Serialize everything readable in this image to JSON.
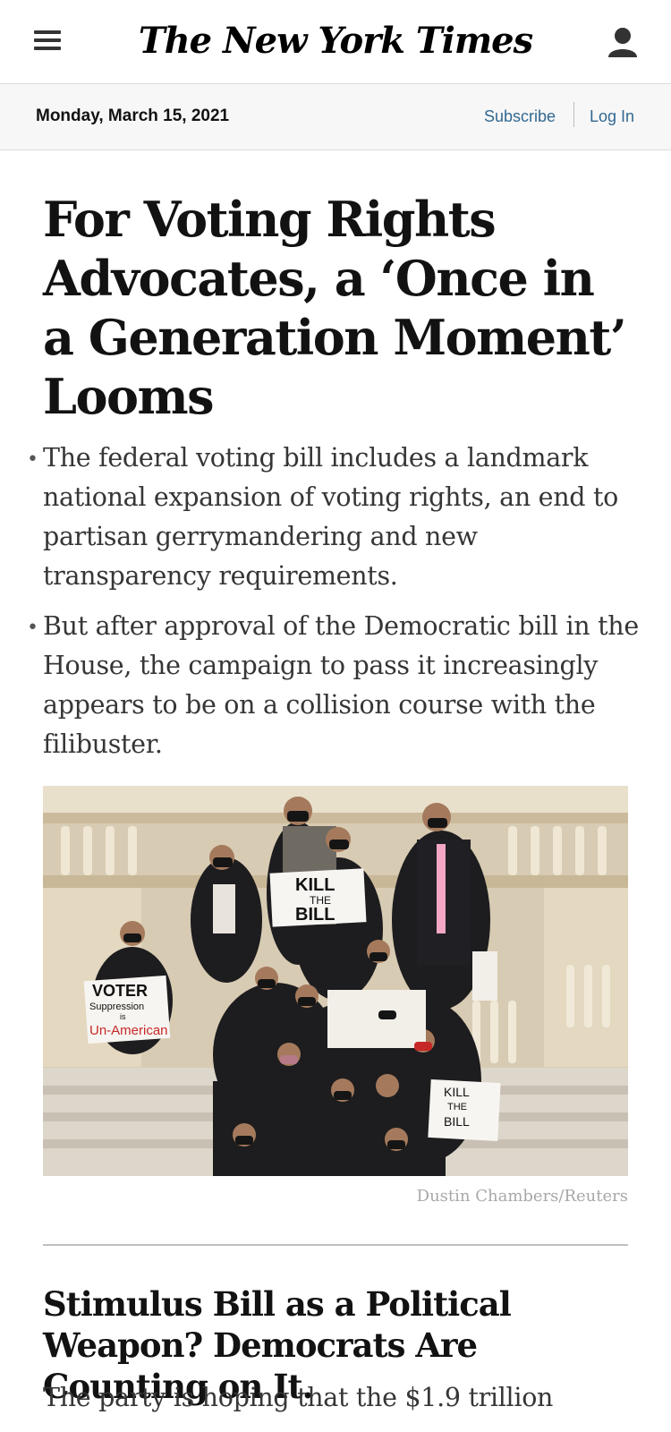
{
  "header": {
    "logo_text": "The New York Times",
    "menu_icon": "hamburger-menu-icon",
    "user_icon": "user-account-icon"
  },
  "datebar": {
    "date": "Monday, March 15, 2021",
    "subscribe_label": "Subscribe",
    "login_label": "Log In"
  },
  "article1": {
    "headline": "For Voting Rights Advocates, a ‘Once in a Generation Moment’ Looms",
    "bullets": [
      "The federal voting bill includes a landmark national expansion of voting rights, an end to partisan gerrymandering and new transparency requirements.",
      "But after approval of the Democratic bill in the House, the campaign to pass it increasingly appears to be on a collision course with the filibuster."
    ],
    "photo": {
      "signs": {
        "kill_bill_top_1": "KILL",
        "kill_bill_top_2": "THE",
        "kill_bill_top_3": "BILL",
        "voter_1": "VOTER",
        "voter_2": "Suppression",
        "voter_3": "is",
        "voter_4": "Un-American",
        "kill_bill_right_1": "KILL",
        "kill_bill_right_2": "THE",
        "kill_bill_right_3": "BILL"
      }
    },
    "photo_credit": "Dustin Chambers/Reuters"
  },
  "article2": {
    "headline": "Stimulus Bill as a Political Weapon? Democrats Are Counting on It.",
    "summary": "The party is hoping that the $1.9 trillion"
  },
  "colors": {
    "link": "#326891",
    "text": "#121212",
    "summary_text": "#363636",
    "credit": "#a8a8a8"
  }
}
